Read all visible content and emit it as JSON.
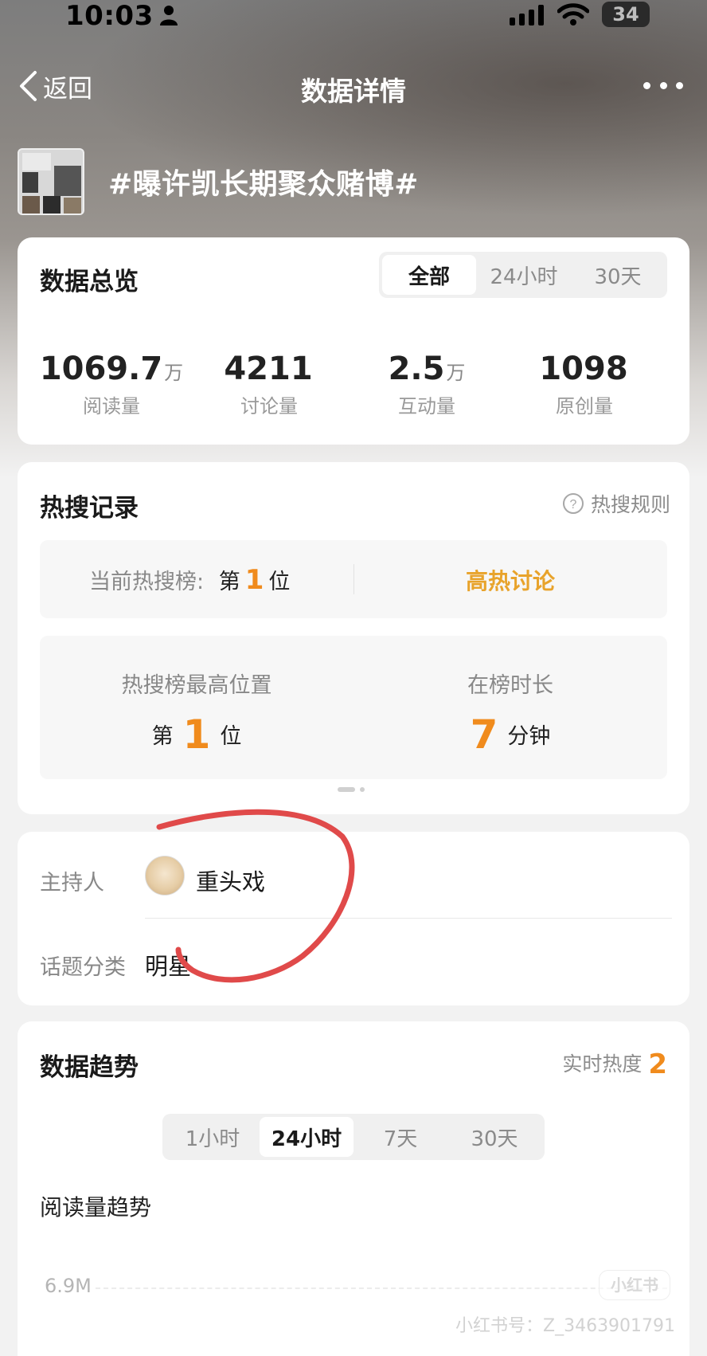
{
  "status_bar": {
    "time": "10:03",
    "battery": "34"
  },
  "nav": {
    "back_label": "返回",
    "title": "数据详情"
  },
  "topic": {
    "title": "#曝许凯长期聚众赌博#"
  },
  "overview": {
    "title": "数据总览",
    "tabs": [
      "全部",
      "24小时",
      "30天"
    ],
    "active_tab": "全部",
    "stats": [
      {
        "value": "1069.7",
        "unit": "万",
        "label": "阅读量"
      },
      {
        "value": "4211",
        "unit": "",
        "label": "讨论量"
      },
      {
        "value": "2.5",
        "unit": "万",
        "label": "互动量"
      },
      {
        "value": "1098",
        "unit": "",
        "label": "原创量"
      }
    ]
  },
  "hot_search": {
    "title": "热搜记录",
    "rules_label": "热搜规则",
    "current_prefix": "当前热搜榜:",
    "current_rank_prefix": "第",
    "current_rank": "1",
    "current_rank_suffix": "位",
    "tag": "高热讨论",
    "best_label": "热搜榜最高位置",
    "best_prefix": "第",
    "best_rank": "1",
    "best_suffix": "位",
    "duration_label": "在榜时长",
    "duration_value": "7",
    "duration_unit": "分钟"
  },
  "info": {
    "host_label": "主持人",
    "host_name": "重头戏",
    "category_label": "话题分类",
    "category_value": "明星"
  },
  "trend": {
    "title": "数据趋势",
    "realtime_label": "实时热度",
    "realtime_value": "2",
    "tabs": [
      "1小时",
      "24小时",
      "7天",
      "30天"
    ],
    "active_tab": "24小时",
    "subtitle": "阅读量趋势",
    "y_tick": "6.9M"
  },
  "watermark": {
    "text": "小红书号：Z_3463901791",
    "logo_text": "小红书"
  },
  "colors": {
    "accent_orange": "#f08b1d",
    "hot_tag": "#e8a32b",
    "annotation_red": "#e04a4a"
  }
}
